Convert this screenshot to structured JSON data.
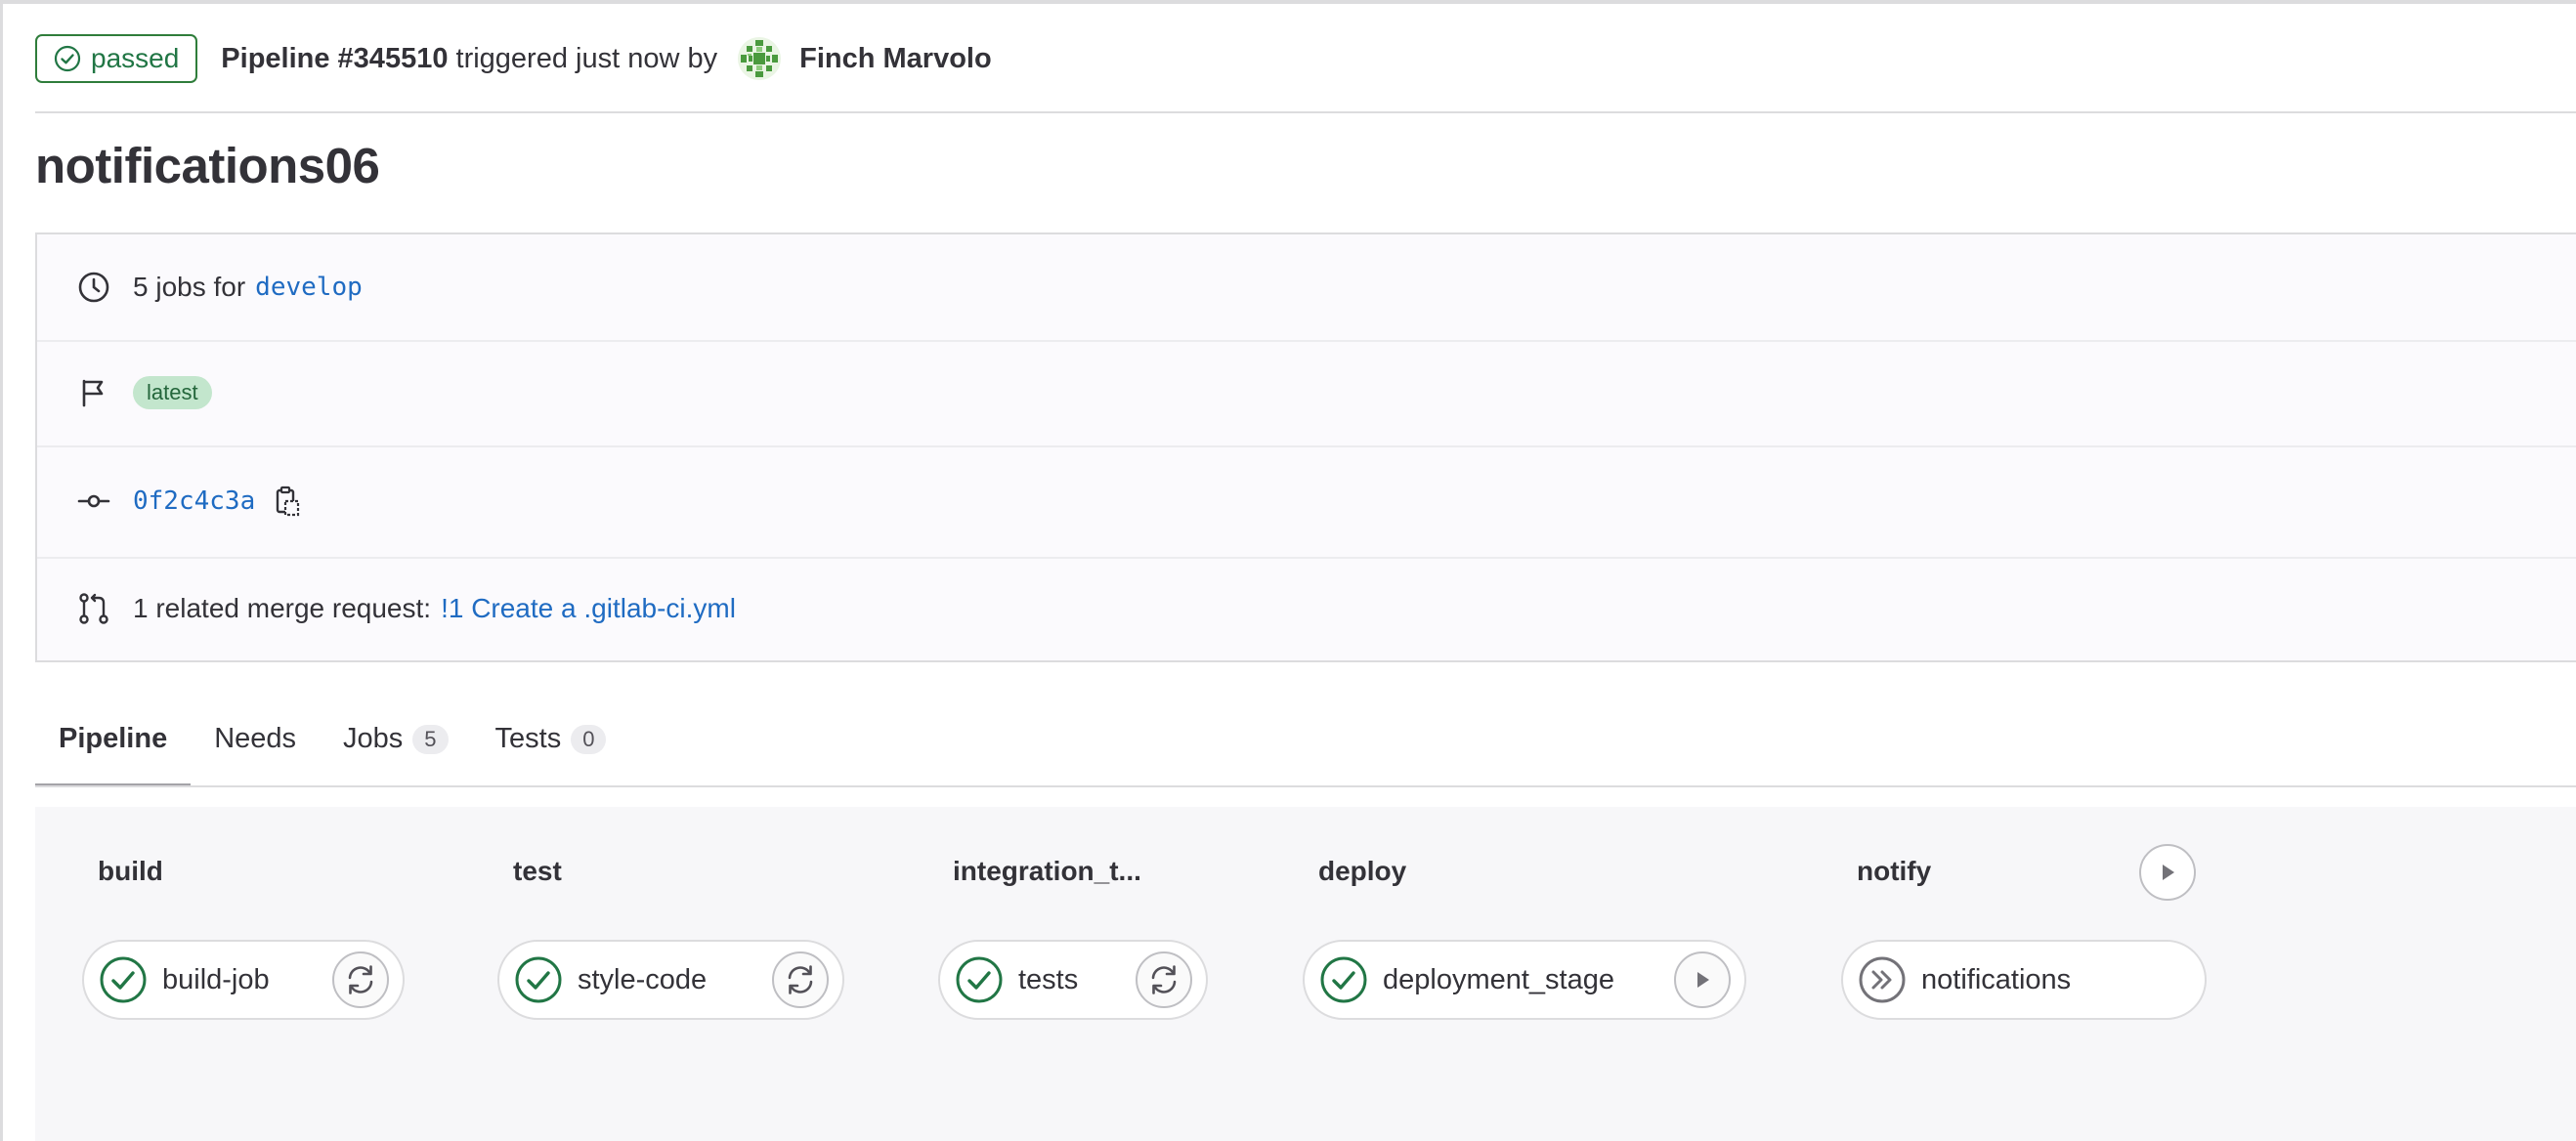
{
  "header": {
    "status": "passed",
    "pipeline_id": "Pipeline #345510",
    "triggered_text": "triggered just now by",
    "author": "Finch Marvolo"
  },
  "title": "notifications06",
  "info": {
    "jobs_prefix": "5 jobs for",
    "branch": "develop",
    "badge": "latest",
    "commit_sha": "0f2c4c3a",
    "mr_prefix": "1 related merge request:",
    "mr_link": "!1 Create a .gitlab-ci.yml"
  },
  "tabs": [
    {
      "label": "Pipeline",
      "count": null
    },
    {
      "label": "Needs",
      "count": null
    },
    {
      "label": "Jobs",
      "count": "5"
    },
    {
      "label": "Tests",
      "count": "0"
    }
  ],
  "stages": [
    {
      "name": "build",
      "job": "build-job",
      "job_status": "success",
      "action": "retry"
    },
    {
      "name": "test",
      "job": "style-code",
      "job_status": "success",
      "action": "retry"
    },
    {
      "name": "integration_t...",
      "job": "tests",
      "job_status": "success",
      "action": "retry"
    },
    {
      "name": "deploy",
      "job": "deployment_stage",
      "job_status": "success",
      "action": "play"
    },
    {
      "name": "notify",
      "job": "notifications",
      "job_status": "skipped",
      "action": "play-stage"
    }
  ],
  "colors": {
    "success": "#217645",
    "link": "#1f6bc2",
    "muted_icon": "#737278"
  },
  "icons": [
    "status-check-icon",
    "clock-icon",
    "flag-icon",
    "commit-icon",
    "copy-icon",
    "merge-request-icon",
    "retry-icon",
    "play-icon",
    "skipped-icon"
  ]
}
